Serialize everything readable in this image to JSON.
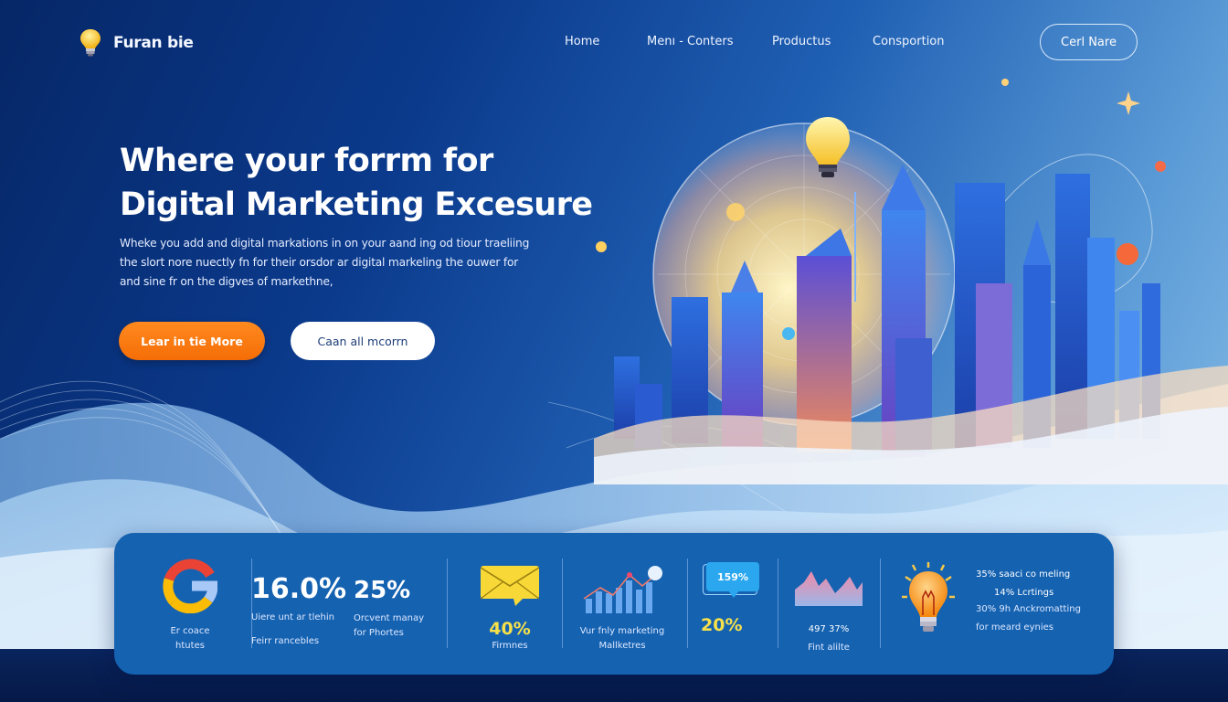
{
  "brand": {
    "name": "Furan bie",
    "logo_icon": "lightbulb-icon"
  },
  "nav": {
    "items": [
      {
        "label": "Home"
      },
      {
        "label": "Menı - Conters"
      },
      {
        "label": "Productus"
      },
      {
        "label": "Consportion"
      }
    ],
    "cta_label": "Cerl Nare"
  },
  "hero": {
    "title_line1": "Where your forrm for",
    "title_line2": "Digital Marketing Excesure",
    "description": "Wheke you add and digital markations in on your aand ing od tiour traeliing the slort nore nuectly fn for their orsdor ar digital markeling the ouwer for and sine fr on the digves of markethne,",
    "primary_button": "Lear in tie More",
    "secondary_button": "Caan all mcorrn",
    "illustration": "city-skyline-with-lightbulb-globe"
  },
  "stats": {
    "google": {
      "icon": "google-g-icon",
      "label_line1": "Er coace",
      "label_line2": "htutes"
    },
    "metric1": {
      "value": "16.0%",
      "label": "Uiere unt ar tlehin",
      "sub": "Feirr rancebles"
    },
    "metric2": {
      "value": "25%",
      "label_line1": "Orcvent manay",
      "label_line2": "for Phortes"
    },
    "email": {
      "icon": "envelope-icon",
      "value": "40%",
      "label": "Firmnes"
    },
    "growth": {
      "icon": "bar-chart-icon",
      "label_line1": "Vur fnly marketing",
      "label_line2": "Mallketres"
    },
    "chat": {
      "icon": "chat-bubble-icon",
      "bubble_value": "159%",
      "value": "20%"
    },
    "area": {
      "icon": "area-chart-icon",
      "value": "497 37%",
      "label": "Fint alilte"
    },
    "insight": {
      "icon": "lightbulb-icon",
      "line1": "35% saaci co meling",
      "line2": "14% Lcrtings",
      "line3": "30% 9h Anckromatting",
      "line4": "for meard eynies"
    }
  },
  "colors": {
    "accent_orange": "#f67a10",
    "panel_blue": "#1562b1",
    "highlight_yellow": "#f7e04a"
  }
}
